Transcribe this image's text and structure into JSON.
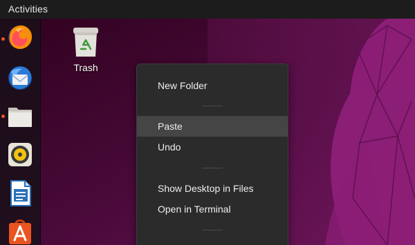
{
  "topbar": {
    "activities_label": "Activities"
  },
  "dock": {
    "items": [
      {
        "name": "Firefox Web Browser",
        "icon": "firefox-icon",
        "running": true
      },
      {
        "name": "Thunderbird Mail",
        "icon": "thunderbird-icon",
        "running": false
      },
      {
        "name": "Files",
        "icon": "files-icon",
        "running": true
      },
      {
        "name": "Rhythmbox",
        "icon": "rhythmbox-icon",
        "running": false
      },
      {
        "name": "LibreOffice Writer",
        "icon": "libreoffice-writer-icon",
        "running": false
      },
      {
        "name": "Ubuntu Software",
        "icon": "ubuntu-software-icon",
        "running": false
      }
    ]
  },
  "desktop": {
    "icons": [
      {
        "label": "Trash",
        "icon": "trash-icon"
      }
    ]
  },
  "context_menu": {
    "items": [
      {
        "label": "New Folder"
      },
      {
        "label": "Paste",
        "hovered": true
      },
      {
        "label": "Undo"
      },
      {
        "label": "Show Desktop in Files"
      },
      {
        "label": "Open in Terminal"
      }
    ]
  },
  "colors": {
    "topbar": "#1c1c1c",
    "wallpaper_dark": "#2c001e",
    "wallpaper_accent": "#8a1e73",
    "menu_background": "#2b2b2b",
    "menu_hover": "#454545",
    "running_indicator": "#e95420"
  }
}
